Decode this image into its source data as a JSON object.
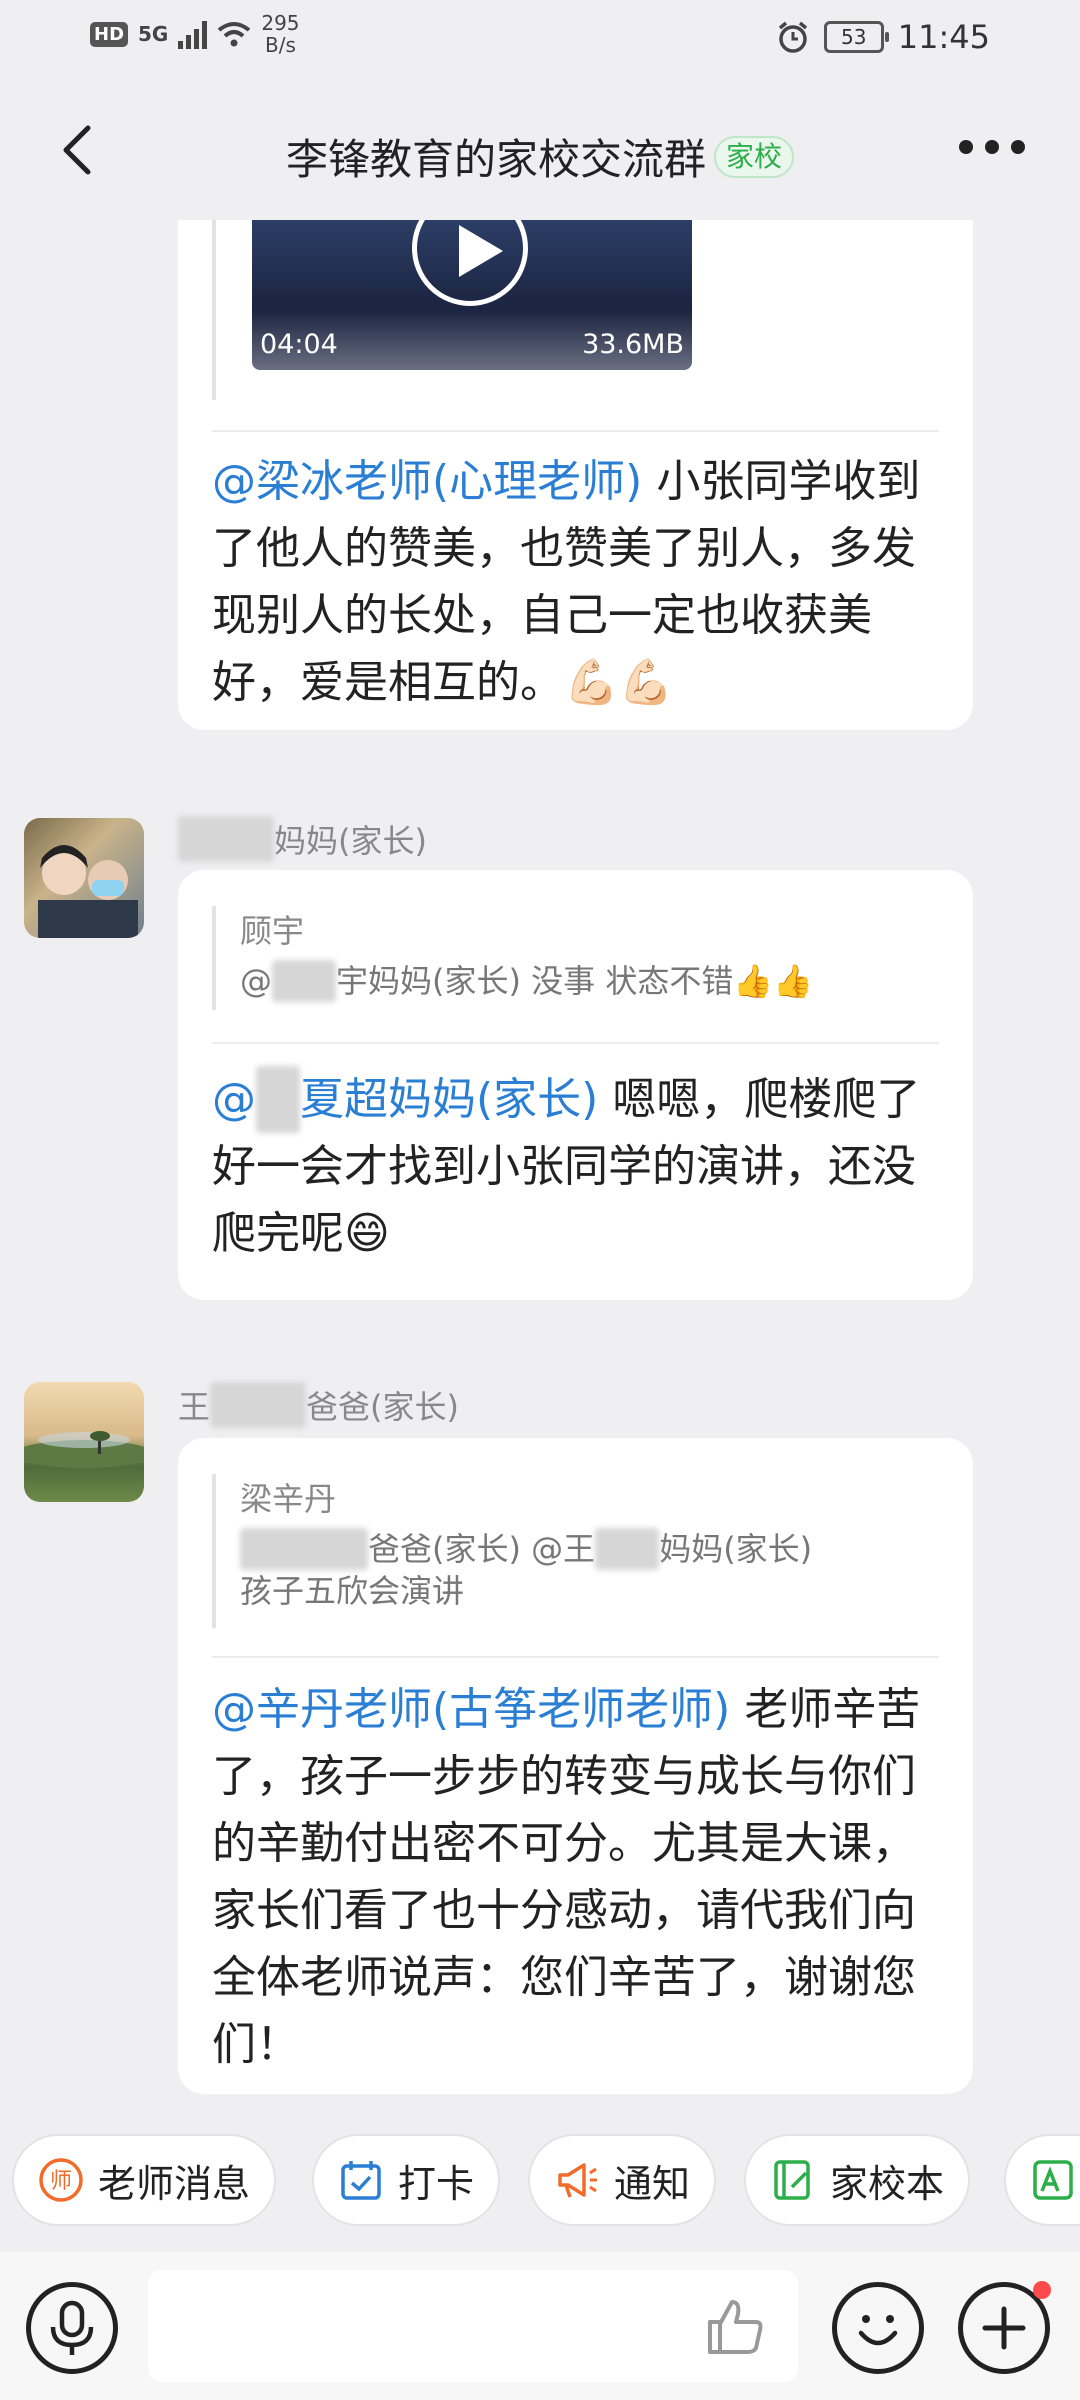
{
  "status_bar": {
    "hd": "HD",
    "network": "5G",
    "speed": "295",
    "speed_unit": "B/s",
    "battery": "53",
    "time": "11:45"
  },
  "header": {
    "title": "李锋教育的家校交流群",
    "tag": "家校"
  },
  "messages": {
    "m1": {
      "video_duration": "04:04",
      "video_size": "33.6MB",
      "mention": "@梁冰老师(心理老师)",
      "text": " 小张同学收到了他人的赞美，也赞美了别人，多发现别人的长处，自己一定也收获美好，爱是相互的。",
      "emoji": "💪🏻💪🏻"
    },
    "m2": {
      "sender_visible": "妈妈(家长)",
      "quote_name": "顾宇",
      "quote_at": "@",
      "quote_visible": "宇妈妈(家长) 没事 状态不错",
      "quote_emoji": "👍👍",
      "mention_visible": "夏超妈妈(家长)",
      "text": " 嗯嗯，爬楼爬了好一会才找到小张同学的演讲，还没爬完呢",
      "emoji": "😄"
    },
    "m3": {
      "sender_prefix": "王",
      "sender_visible": "爸爸(家长)",
      "quote_name": "梁辛丹",
      "quote_line1_a": "爸爸(家长) @王",
      "quote_line1_b": "妈妈(家长)",
      "quote_line2": "孩子五欣会演讲",
      "mention": "@辛丹老师(古筝老师老师)",
      "text": " 老师辛苦了，孩子一步步的转变与成长与你们的辛勤付出密不可分。尤其是大课，家长们看了也十分感动，请代我们向全体老师说声：您们辛苦了，谢谢您们！"
    }
  },
  "chips": [
    {
      "label": "老师消息",
      "icon": "teacher-icon",
      "color": "#f26b2a"
    },
    {
      "label": "打卡",
      "icon": "checkin-calendar-icon",
      "color": "#2a7fd4"
    },
    {
      "label": "通知",
      "icon": "megaphone-icon",
      "color": "#f26b2a"
    },
    {
      "label": "家校本",
      "icon": "notebook-icon",
      "color": "#2cae4a"
    }
  ],
  "icons": {
    "back": "back-arrow-icon",
    "more": "more-dots-icon",
    "voice": "voice-icon",
    "like": "thumbs-up-icon",
    "emoji": "emoji-icon",
    "add": "add-icon"
  }
}
